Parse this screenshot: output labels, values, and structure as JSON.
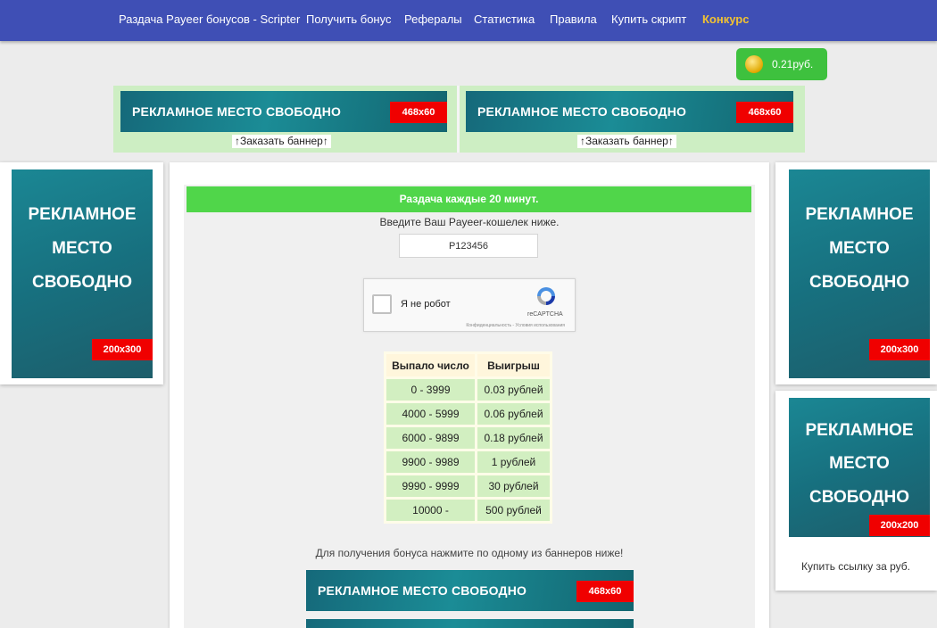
{
  "nav": {
    "items": [
      {
        "label": "Раздача Payeer бонусов - Scripter"
      },
      {
        "label": "Получить бонус"
      },
      {
        "label": "Рефералы"
      },
      {
        "label": "Статистика"
      },
      {
        "label": "Правила"
      },
      {
        "label": "Купить скрипт"
      },
      {
        "label": "Конкурс"
      }
    ],
    "contest_color": "#f1c232"
  },
  "balance": {
    "value": "0.21руб.",
    "icon": "coin-icon"
  },
  "top_banners": [
    {
      "text": "РЕКЛАМНОЕ  МЕСТО СВОБОДНО",
      "size": "468x60",
      "order": "↑Заказать баннер↑"
    },
    {
      "text": "РЕКЛАМНОЕ  МЕСТО СВОБОДНО",
      "size": "468x60",
      "order": "↑Заказать баннер↑"
    }
  ],
  "left_banner": {
    "lines": [
      "РЕКЛАМНОЕ",
      "МЕСТО",
      "СВОБОДНО"
    ],
    "size": "200x300"
  },
  "right_banners": [
    {
      "lines": [
        "РЕКЛАМНОЕ",
        "МЕСТО",
        "СВОБОДНО"
      ],
      "size": "200x300"
    },
    {
      "lines": [
        "РЕКЛАМНОЕ",
        "МЕСТО",
        "СВОБОДНО"
      ],
      "size": "200x200"
    }
  ],
  "buy_link": "Купить ссылку за руб.",
  "main": {
    "header": "Раздача каждые 20 минут.",
    "prompt": "Введите Ваш Payeer-кошелек ниже.",
    "wallet_value": "P123456",
    "captcha": {
      "label": "Я не робот",
      "brand": "reCAPTCHA",
      "privacy": "Конфиденциальность - Условия использования"
    },
    "table": {
      "headers": [
        "Выпало число",
        "Выигрыш"
      ],
      "rows": [
        [
          "0 - 3999",
          "0.03 рублей"
        ],
        [
          "4000 - 5999",
          "0.06 рублей"
        ],
        [
          "6000 - 9899",
          "0.18 рублей"
        ],
        [
          "9900 - 9989",
          "1 рублей"
        ],
        [
          "9990 - 9999",
          "30 рублей"
        ],
        [
          "10000 -",
          "500 рублей"
        ]
      ]
    },
    "hint": "Для получения бонуса нажмите по одному из баннеров ниже!",
    "bottom_banners": [
      {
        "text": "РЕКЛАМНОЕ  МЕСТО СВОБОДНО",
        "size": "468x60"
      }
    ]
  },
  "colors": {
    "nav_bg": "#3f4fb5",
    "balance_bg": "#3ec13e",
    "green_bar": "#50d64a",
    "size_badge": "#f00000",
    "banner_teal": "#17707f"
  }
}
